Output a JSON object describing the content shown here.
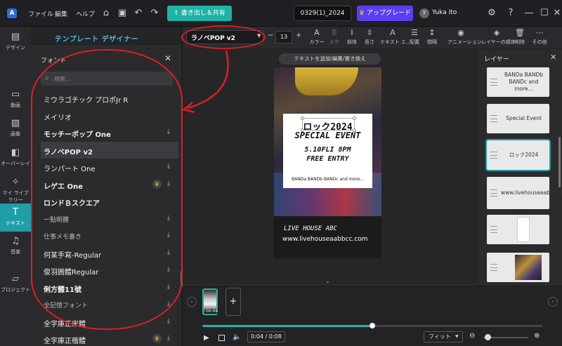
{
  "topbar": {
    "menu": [
      "ファイル",
      "編集",
      "ヘルプ"
    ],
    "export_label": "書き出し＆共有",
    "project_name": "0329(1)_2024",
    "upgrade_label": "アップグレード",
    "avatar_initial": "Y",
    "username": "Yuka Ito"
  },
  "designer": {
    "title": "テンプレート デザイナー"
  },
  "sidebar": {
    "items": [
      {
        "icon": "design-icon",
        "label": "デザイン"
      },
      {
        "icon": "video-icon",
        "label": "動画"
      },
      {
        "icon": "image-icon",
        "label": "画像"
      },
      {
        "icon": "overlay-icon",
        "label": "オーバーレイ"
      },
      {
        "icon": "my-library-icon",
        "label": "マイ ライブラリー"
      },
      {
        "icon": "text-icon",
        "label": "テキスト"
      },
      {
        "icon": "music-icon",
        "label": "音楽"
      },
      {
        "icon": "project-icon",
        "label": "プロジェクト"
      }
    ]
  },
  "font_panel": {
    "title": "フォント",
    "search_placeholder": "検索...",
    "fonts": [
      {
        "name": "ミウラゴチック プロポJr R",
        "download": false,
        "premium": false,
        "selected": false
      },
      {
        "name": "メイリオ",
        "download": false,
        "premium": false,
        "selected": false
      },
      {
        "name": "モッチーポップ One",
        "download": true,
        "premium": false,
        "selected": false
      },
      {
        "name": "ラノベPOP v2",
        "download": false,
        "premium": false,
        "selected": true
      },
      {
        "name": "ランパート One",
        "download": true,
        "premium": false,
        "selected": false
      },
      {
        "name": "レゲエ One",
        "download": true,
        "premium": true,
        "selected": false
      },
      {
        "name": "ロンドＢスクエア",
        "download": false,
        "premium": false,
        "selected": false
      },
      {
        "name": "一點明體",
        "download": true,
        "premium": false,
        "selected": false
      },
      {
        "name": "仕事メモ書き",
        "download": true,
        "premium": false,
        "selected": false
      },
      {
        "name": "何某手寫-Regular",
        "download": true,
        "premium": false,
        "selected": false
      },
      {
        "name": "俊羽圓體Regular",
        "download": true,
        "premium": false,
        "selected": false
      },
      {
        "name": "俐方體11號",
        "download": true,
        "premium": false,
        "selected": false
      },
      {
        "name": "全記憶フォント",
        "download": true,
        "premium": false,
        "selected": false
      },
      {
        "name": "全字庫正宋體",
        "download": true,
        "premium": false,
        "selected": false
      },
      {
        "name": "全字庫正楷體",
        "download": true,
        "premium": true,
        "selected": false
      }
    ]
  },
  "format_bar": {
    "font_value": "ラノベPOP v2",
    "size_value": "13",
    "tools": [
      {
        "icon": "color-icon",
        "glyph": "A",
        "label": "カラー",
        "disabled": false
      },
      {
        "icon": "bold-icon",
        "glyph": "B",
        "label": "太字",
        "disabled": true
      },
      {
        "icon": "italic-icon",
        "glyph": "I",
        "label": "斜体",
        "disabled": false
      },
      {
        "icon": "length-icon",
        "glyph": "⇳",
        "label": "長さ",
        "disabled": false
      },
      {
        "icon": "text-effect-icon",
        "glyph": "Ａ",
        "label": "テキスト エ...",
        "disabled": false
      },
      {
        "icon": "align-icon",
        "glyph": "☰",
        "label": "配置",
        "disabled": false
      },
      {
        "icon": "spacing-icon",
        "glyph": "↕",
        "label": "間隔",
        "disabled": false
      },
      {
        "icon": "animation-icon",
        "glyph": "◉",
        "label": "アニメーション",
        "disabled": false
      },
      {
        "icon": "layer-order-icon",
        "glyph": "◈",
        "label": "レイヤーの順序",
        "disabled": false
      },
      {
        "icon": "delete-icon",
        "glyph": "🗑",
        "label": "削除",
        "disabled": false
      },
      {
        "icon": "more-icon",
        "glyph": "⋯",
        "label": "その他",
        "disabled": false
      }
    ]
  },
  "canvas": {
    "hint": "テキストを追加/編集/置き換え",
    "card_title": "ロック2024",
    "card_event": "SPECIAL EVENT",
    "card_date": "5.10FLI 8PM",
    "card_entry": "FREE ENTRY",
    "card_bands": "BANDa BANDb BANDc and more...",
    "venue": "LIVE HOUSE ABC",
    "venue_url": "www.livehouseaabbcc.com"
  },
  "layers": {
    "title": "レイヤー",
    "items": [
      {
        "text": "BANDa BANDb BANDc and more...",
        "selected": false,
        "kind": "text"
      },
      {
        "text": "Special Event",
        "selected": false,
        "kind": "text"
      },
      {
        "text": "ロック2024",
        "selected": true,
        "kind": "text"
      },
      {
        "text": "www.livehouseaabbcc.com",
        "selected": false,
        "kind": "text"
      },
      {
        "text": "",
        "selected": false,
        "kind": "white-rect"
      },
      {
        "text": "",
        "selected": false,
        "kind": "photo"
      }
    ]
  },
  "timeline": {
    "clip_time": "00:08",
    "time_display": "0:04 / 0:08",
    "progress": 0.5,
    "fit_label": "フィット",
    "zoom": 0.1
  },
  "colors": {
    "accent": "#1fb2a6",
    "upgrade": "#5a3ff0",
    "annotation": "#d82020"
  }
}
